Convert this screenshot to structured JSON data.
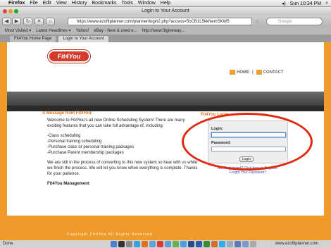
{
  "menubar": {
    "app_name": "Firefox",
    "items": [
      "File",
      "Edit",
      "View",
      "History",
      "Bookmarks",
      "Tools",
      "Window",
      "Help"
    ],
    "clock": "Sun 10:34 PM"
  },
  "window": {
    "title": "Login to Your Account"
  },
  "navbar": {
    "url": "https://www.ezofitplanner.com/planner/login2.php?access=5oCB1L5kkNemSKW5",
    "search_placeholder": "Google"
  },
  "bookmarks": [
    "Most Visited ▾",
    "Latest Headlines ▾",
    "Yahoo!",
    "eBay - New & used e...",
    "http://www.fitgiveway..."
  ],
  "tabs": [
    {
      "label": "Fit4You Home Page",
      "active": false
    },
    {
      "label": "Login to Your Account",
      "active": true
    }
  ],
  "site": {
    "logo_text": "Fit4You",
    "nav_home": "HOME",
    "nav_contact": "CONTACT"
  },
  "message": {
    "title": "A Message from Fit4You:",
    "intro": "Welcome to Fit4You's all new Online Scheduling System! There are many exciting features that you can take full advantage of, including:",
    "features": [
      "-Class scheduling",
      "-Personal training scheduling",
      "-Purchase class or personal training packages",
      "-Purchase Parent membership packages"
    ],
    "note": "We are still in the process of converting to this new system so bear with us while we finish the process. We will let you know when everything is complete. Thanks for your patience.",
    "signature": "Fit4You Management"
  },
  "login": {
    "title": "Fit4You Login",
    "login_label": "Login:",
    "password_label": "Password:",
    "login_value": "",
    "password_value": "",
    "button_label": "Login",
    "register_text": "Not Registered? Click here to Register.",
    "forgot_text": "Forgot Your Password?"
  },
  "footer_text": "Copyright Fit4You All Rights Reserved",
  "statusbar": {
    "left": "Done",
    "right": "www.ezofitplanner.com"
  },
  "colors": {
    "brand_orange": "#ef9a2a",
    "accent": "#e0731a",
    "annotation_red": "#e02a10"
  }
}
